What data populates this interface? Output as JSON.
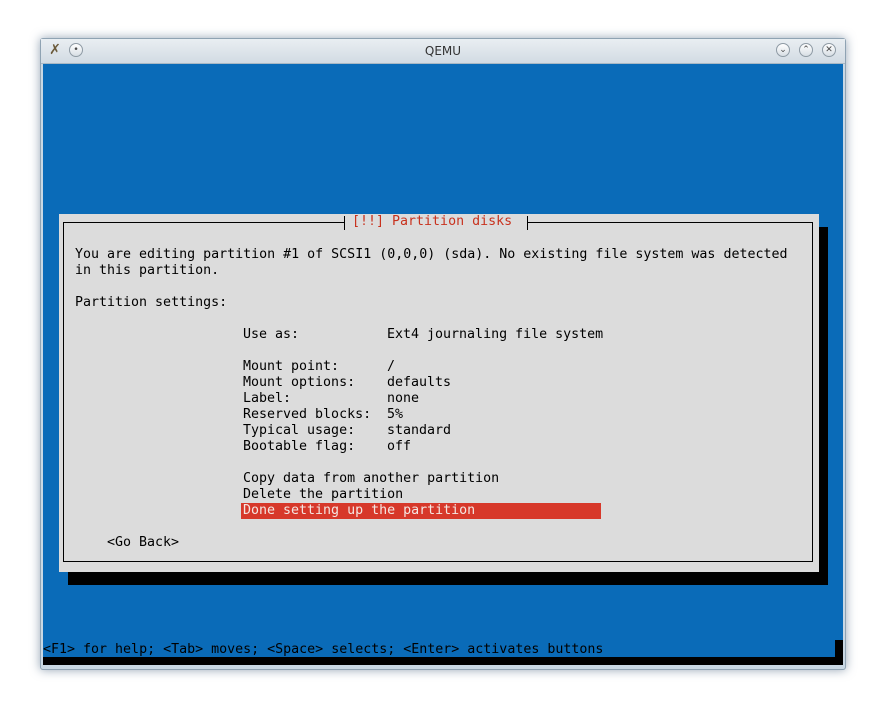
{
  "window": {
    "title": "QEMU",
    "app_icon": "qemu-icon",
    "buttons": [
      {
        "name": "minimize-button",
        "glyph": "⌄"
      },
      {
        "name": "maximize-button",
        "glyph": "⌃"
      },
      {
        "name": "close-button",
        "glyph": "✕"
      }
    ],
    "menu_glyph": "•"
  },
  "dialog": {
    "title": "[!!] Partition disks",
    "intro_line1": "You are editing partition #1 of SCSI1 (0,0,0) (sda). No existing file system was detected",
    "intro_line2": "in this partition.",
    "settings_heading": "Partition settings:",
    "settings": [
      {
        "label": "Use as:",
        "value": "Ext4 journaling file system"
      },
      {
        "label": "Mount point:",
        "value": "/"
      },
      {
        "label": "Mount options:",
        "value": "defaults"
      },
      {
        "label": "Label:",
        "value": "none"
      },
      {
        "label": "Reserved blocks:",
        "value": "5%"
      },
      {
        "label": "Typical usage:",
        "value": "standard"
      },
      {
        "label": "Bootable flag:",
        "value": "off"
      }
    ],
    "actions": [
      "Copy data from another partition",
      "Delete the partition",
      "Done setting up the partition"
    ],
    "selected_action_index": 2,
    "go_back": "<Go Back>"
  },
  "status_bar": {
    "text": "<F1> for help; <Tab> moves; <Space> selects; <Enter> activates buttons"
  },
  "colors": {
    "screen_bg": "#0a6bb8",
    "dialog_bg": "#dcdcdc",
    "title_color": "#c8321e",
    "selection_bg": "#d7382a"
  }
}
